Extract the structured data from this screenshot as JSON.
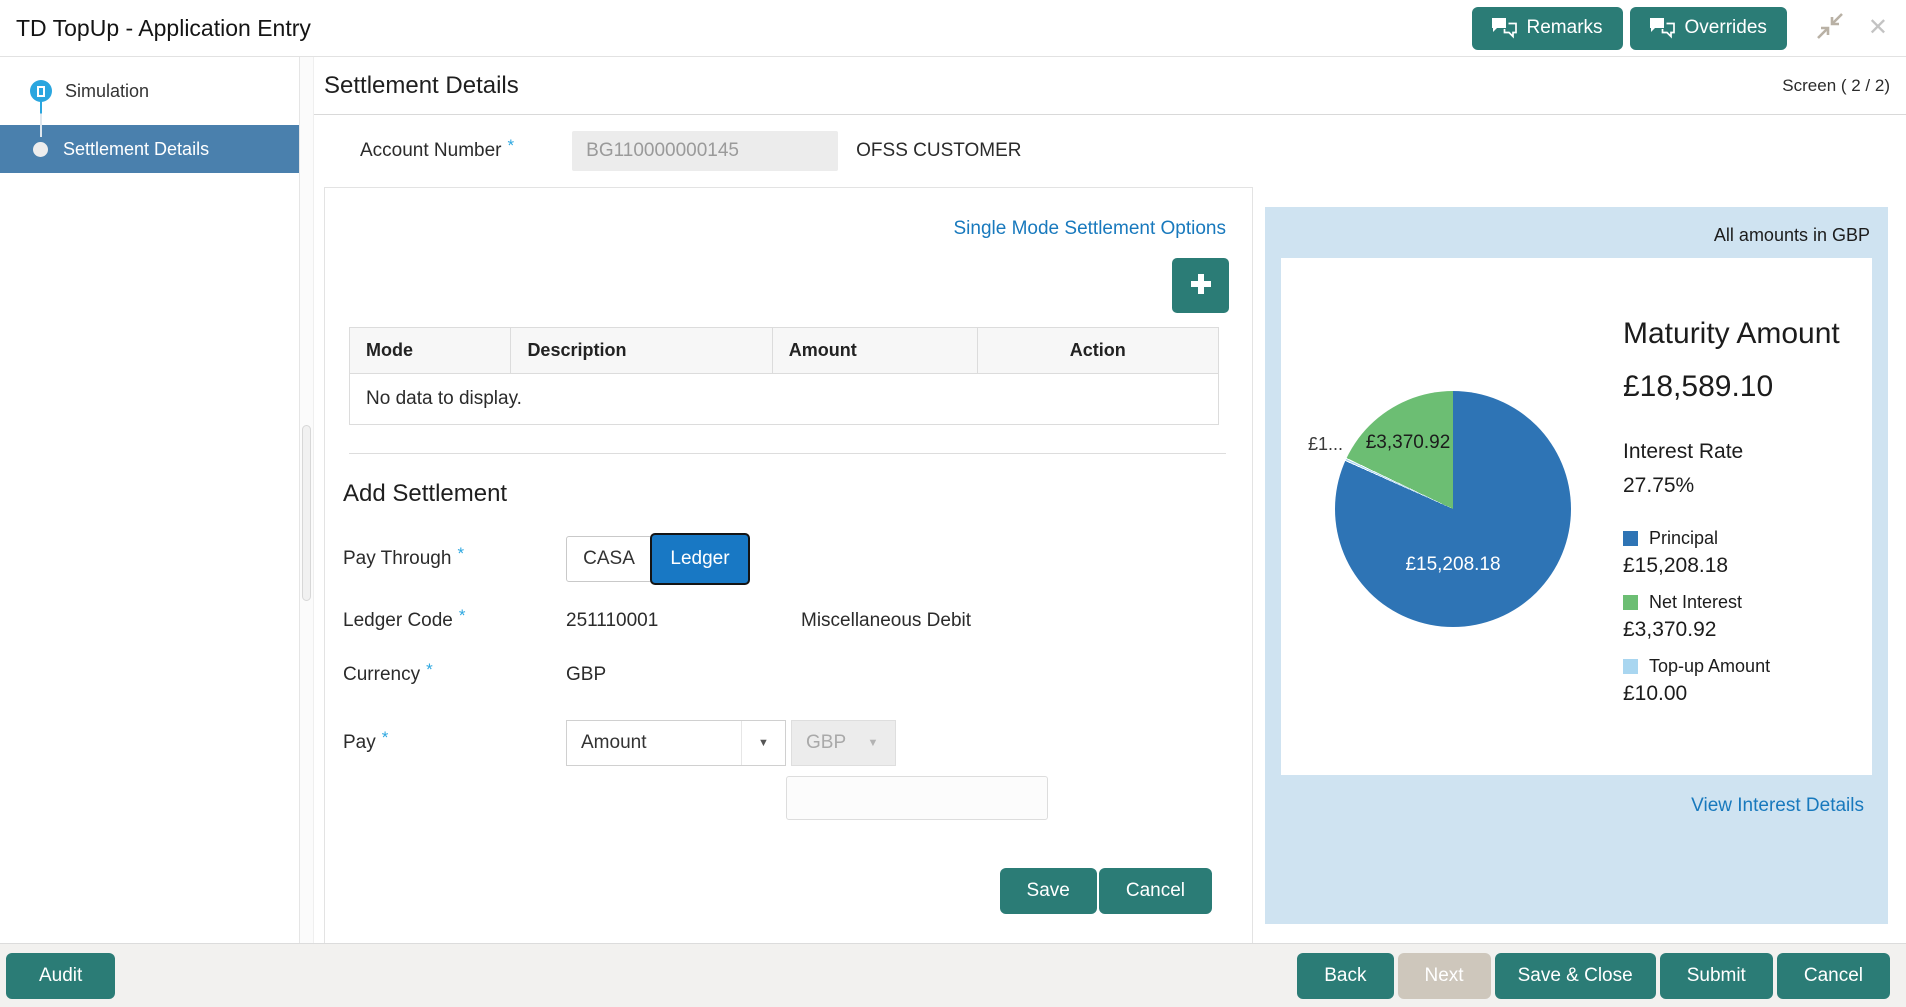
{
  "header": {
    "title": "TD TopUp - Application Entry",
    "remarks_label": "Remarks",
    "overrides_label": "Overrides"
  },
  "icons": {
    "close": "✕",
    "chevron_down": "▼"
  },
  "sidebar": {
    "items": [
      {
        "label": "Simulation"
      },
      {
        "label": "Settlement Details"
      }
    ]
  },
  "main": {
    "title": "Settlement Details",
    "screen_indicator": "Screen ( 2 / 2)",
    "required_marker": "*",
    "account": {
      "label": "Account Number",
      "value": "BG110000000145",
      "customer": "OFSS CUSTOMER"
    },
    "settlement_options_link": "Single Mode Settlement Options",
    "table": {
      "columns": [
        "Mode",
        "Description",
        "Amount",
        "Action"
      ],
      "empty_message": "No data to display."
    },
    "add_settlement": {
      "title": "Add Settlement",
      "pay_through_label": "Pay Through",
      "casa_label": "CASA",
      "ledger_label": "Ledger",
      "ledger_code_label": "Ledger Code",
      "ledger_code_value": "251110001",
      "ledger_code_desc": "Miscellaneous Debit",
      "currency_label": "Currency",
      "currency_value": "GBP",
      "pay_label": "Pay",
      "pay_type_value": "Amount",
      "pay_currency_value": "GBP",
      "save_label": "Save",
      "cancel_label": "Cancel"
    }
  },
  "summary_panel": {
    "amounts_note": "All amounts in GBP",
    "maturity_label": "Maturity Amount",
    "maturity_value": "£18,589.10",
    "interest_rate_label": "Interest Rate",
    "interest_rate_value": "27.75%",
    "view_interest_link": "View Interest Details"
  },
  "chart_data": {
    "type": "pie",
    "title": "Maturity Amount breakdown (GBP)",
    "total_value": 18589.1,
    "legend_position": "right",
    "draw_order": [
      0,
      2,
      1
    ],
    "series": [
      {
        "name": "Principal",
        "value": 15208.18,
        "label": "£15,208.18",
        "color": "#2e74b5"
      },
      {
        "name": "Net Interest",
        "value": 3370.92,
        "label": "£3,370.92",
        "color": "#6cbe73"
      },
      {
        "name": "Top-up Amount",
        "value": 10.0,
        "label": "£10.00",
        "truncated_label": "£1...",
        "color": "#a9d6f0"
      }
    ]
  },
  "footer": {
    "audit_label": "Audit",
    "back_label": "Back",
    "next_label": "Next",
    "save_close_label": "Save & Close",
    "submit_label": "Submit",
    "cancel_label": "Cancel"
  },
  "colors": {
    "accent_teal": "#2b7c76",
    "sidebar_selected": "#4a80ad",
    "link_blue": "#1879bd",
    "ledger_selected_blue": "#1878c4",
    "panel_background": "#cfe3f1",
    "disabled_button": "#cec7bc"
  }
}
